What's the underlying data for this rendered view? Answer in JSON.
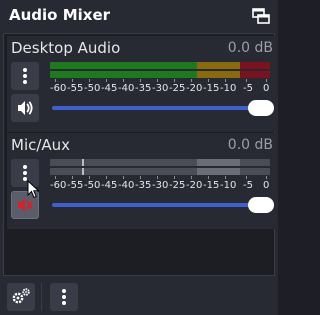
{
  "dock": {
    "title": "Audio Mixer",
    "undock_icon": "undock-window-icon"
  },
  "colors": {
    "meter_green": "#1f7a1f",
    "meter_yellow": "#8a6a10",
    "meter_red": "#7a1220",
    "meter_inactive": "#4a4d55",
    "meter_inactive_light": "#6a6d75",
    "slider_blue": "#3e5fd0",
    "muted_red": "#d0232b"
  },
  "scale_labels": [
    "-60",
    "-55",
    "-50",
    "-45",
    "-40",
    "-35",
    "-30",
    "-25",
    "-20",
    "-15",
    "-10",
    "-5",
    "0"
  ],
  "channels": [
    {
      "name": "Desktop Audio",
      "level": "0.0 dB",
      "muted": false,
      "menu_icon": "vertical-dots-icon",
      "mute_icon": "speaker-icon",
      "volume_fraction": 1.0
    },
    {
      "name": "Mic/Aux",
      "level": "0.0 dB",
      "muted": true,
      "menu_icon": "vertical-dots-icon",
      "mute_icon": "speaker-muted-icon",
      "volume_fraction": 1.0
    }
  ],
  "footer": {
    "settings_icon": "advanced-audio-properties-gear-icon",
    "menu_icon": "vertical-dots-icon"
  }
}
